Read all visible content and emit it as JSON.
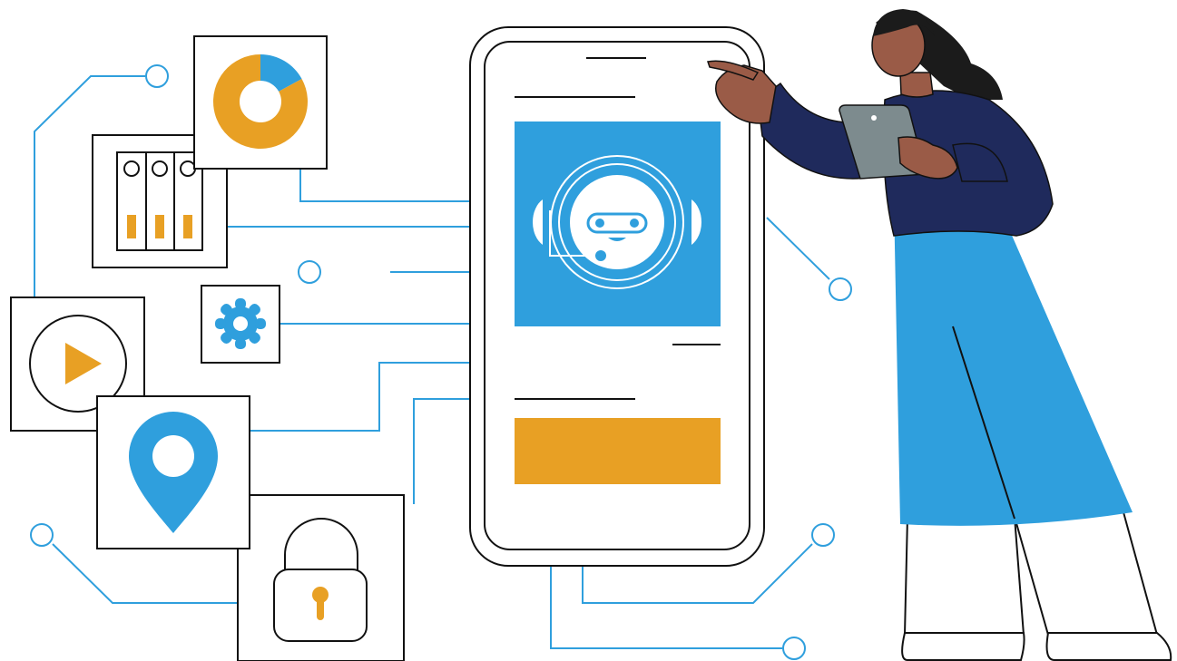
{
  "colors": {
    "blue": "#2f9fdd",
    "orange": "#e8a024",
    "navy": "#1f2a5c",
    "skin": "#9a5b47",
    "hair": "#1b1b1b",
    "tablet": "#7d8b8e",
    "outline": "#111111",
    "white": "#ffffff"
  },
  "icons": {
    "donut": "donut-chart-icon",
    "folders": "file-binders-icon",
    "gear": "gear-icon",
    "play": "play-icon",
    "location": "location-pin-icon",
    "lock": "padlock-icon",
    "robot": "robot-support-icon"
  },
  "donut_chart": {
    "slices": [
      0.17,
      0.83
    ]
  }
}
